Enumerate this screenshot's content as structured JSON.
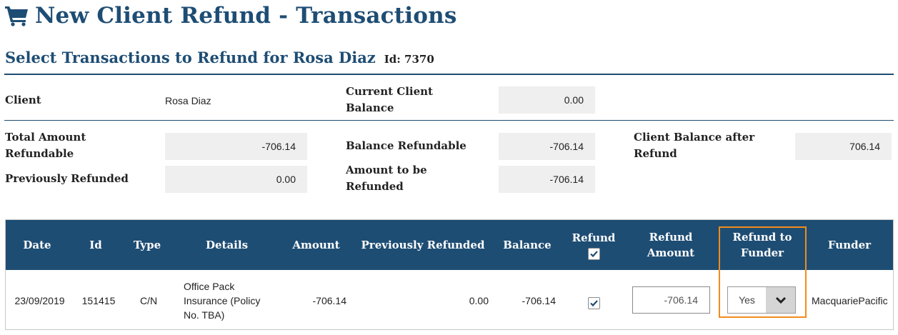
{
  "page": {
    "title": "New Client Refund - Transactions"
  },
  "section": {
    "title": "Select Transactions to Refund for Rosa Diaz",
    "id_label": "Id: 7370"
  },
  "client_info": {
    "client_label": "Client",
    "client_value": "Rosa Diaz",
    "current_balance_label": "Current Client Balance",
    "current_balance_value": "0.00"
  },
  "summary": {
    "total_refundable_label": "Total Amount Refundable",
    "total_refundable_value": "-706.14",
    "previously_refunded_label": "Previously Refunded",
    "previously_refunded_value": "0.00",
    "balance_refundable_label": "Balance Refundable",
    "balance_refundable_value": "-706.14",
    "amount_to_refund_label": "Amount to be Refunded",
    "amount_to_refund_value": "-706.14",
    "balance_after_label": "Client Balance after Refund",
    "balance_after_value": "706.14"
  },
  "table": {
    "headers": {
      "date": "Date",
      "id": "Id",
      "type": "Type",
      "details": "Details",
      "amount": "Amount",
      "previously_refunded": "Previously Refunded",
      "balance": "Balance",
      "refund": "Refund",
      "refund_amount": "Refund Amount",
      "refund_to_funder": "Refund to Funder",
      "funder": "Funder"
    },
    "rows": [
      {
        "date": "23/09/2019",
        "id": "151415",
        "type": "C/N",
        "details": "Office Pack Insurance (Policy No. TBA)",
        "amount": "-706.14",
        "previously_refunded": "0.00",
        "balance": "-706.14",
        "refund_checked": true,
        "refund_amount": "-706.14",
        "refund_to_funder": "Yes",
        "funder": "MacquariePacific"
      }
    ]
  },
  "colors": {
    "primary": "#1e4d74",
    "highlight": "#f08c1c",
    "field_bg": "#efefef"
  },
  "icons": {
    "title_icon": "shopping-cart-icon",
    "checkbox": "checkmark-icon",
    "dropdown": "chevron-down-icon"
  }
}
